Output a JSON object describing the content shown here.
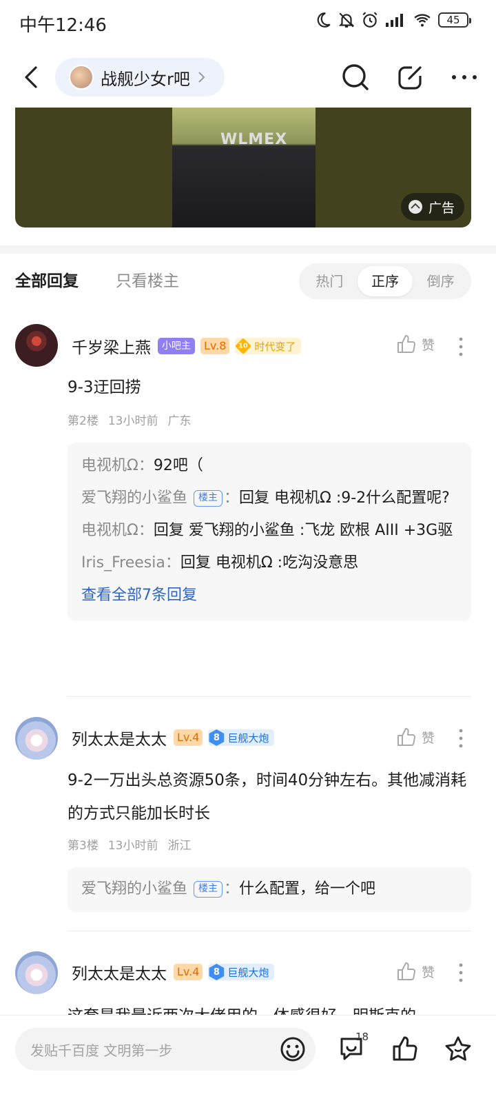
{
  "status": {
    "time": "中午12:46",
    "battery": "45"
  },
  "nav": {
    "forum_name": "战舰少女r吧"
  },
  "ad": {
    "badge_label": "广告",
    "jacket_text": "WLMEX"
  },
  "tabs": {
    "all": "全部回复",
    "owner_only": "只看楼主",
    "sort": [
      "热门",
      "正序",
      "倒序"
    ],
    "sort_active": "正序"
  },
  "posts": [
    {
      "username": "千岁梁上燕",
      "role_tag": "小吧主",
      "level": "Lv.8",
      "badge_num": "10",
      "badge_text": "时代变了",
      "like_label": "赞",
      "content": "9-3迂回捞",
      "floor": "第2楼",
      "time": "13小时前",
      "location": "广东",
      "replies": [
        {
          "name": "电视机Ω",
          "sep": "：",
          "text": "92吧（"
        },
        {
          "name": "爱飞翔的小鲨鱼",
          "host_tag": "楼主",
          "sep": "：",
          "text": "回复 电视机Ω :9-2什么配置呢?"
        },
        {
          "name": "电视机Ω",
          "sep": "：",
          "text": "回复 爱飞翔的小鲨鱼 :飞龙 欧根 AIII +3G驱"
        },
        {
          "name": "Iris_Freesia",
          "sep": "：",
          "text": "回复 电视机Ω :吃沟没意思"
        }
      ],
      "view_all": "查看全部7条回复"
    },
    {
      "username": "列太太是太太",
      "level": "Lv.4",
      "badge_num": "8",
      "badge_text": "巨舰大炮",
      "like_label": "赞",
      "content": "9-2一万出头总资源50条，时间40分钟左右。其他减消耗的方式只能加长时长",
      "floor": "第3楼",
      "time": "13小时前",
      "location": "浙江",
      "replies": [
        {
          "name": "爱飞翔的小鲨鱼",
          "host_tag": "楼主",
          "sep": "：",
          "text": "什么配置，给一个吧"
        }
      ]
    },
    {
      "username": "列太太是太太",
      "level": "Lv.4",
      "badge_num": "8",
      "badge_text": "巨舰大炮",
      "like_label": "赞",
      "content": "这套是我最近两次大佬用的，体感很好，明斯克的"
    }
  ],
  "bottom": {
    "placeholder": "发贴千百度 文明第一步",
    "comment_count": "18"
  }
}
